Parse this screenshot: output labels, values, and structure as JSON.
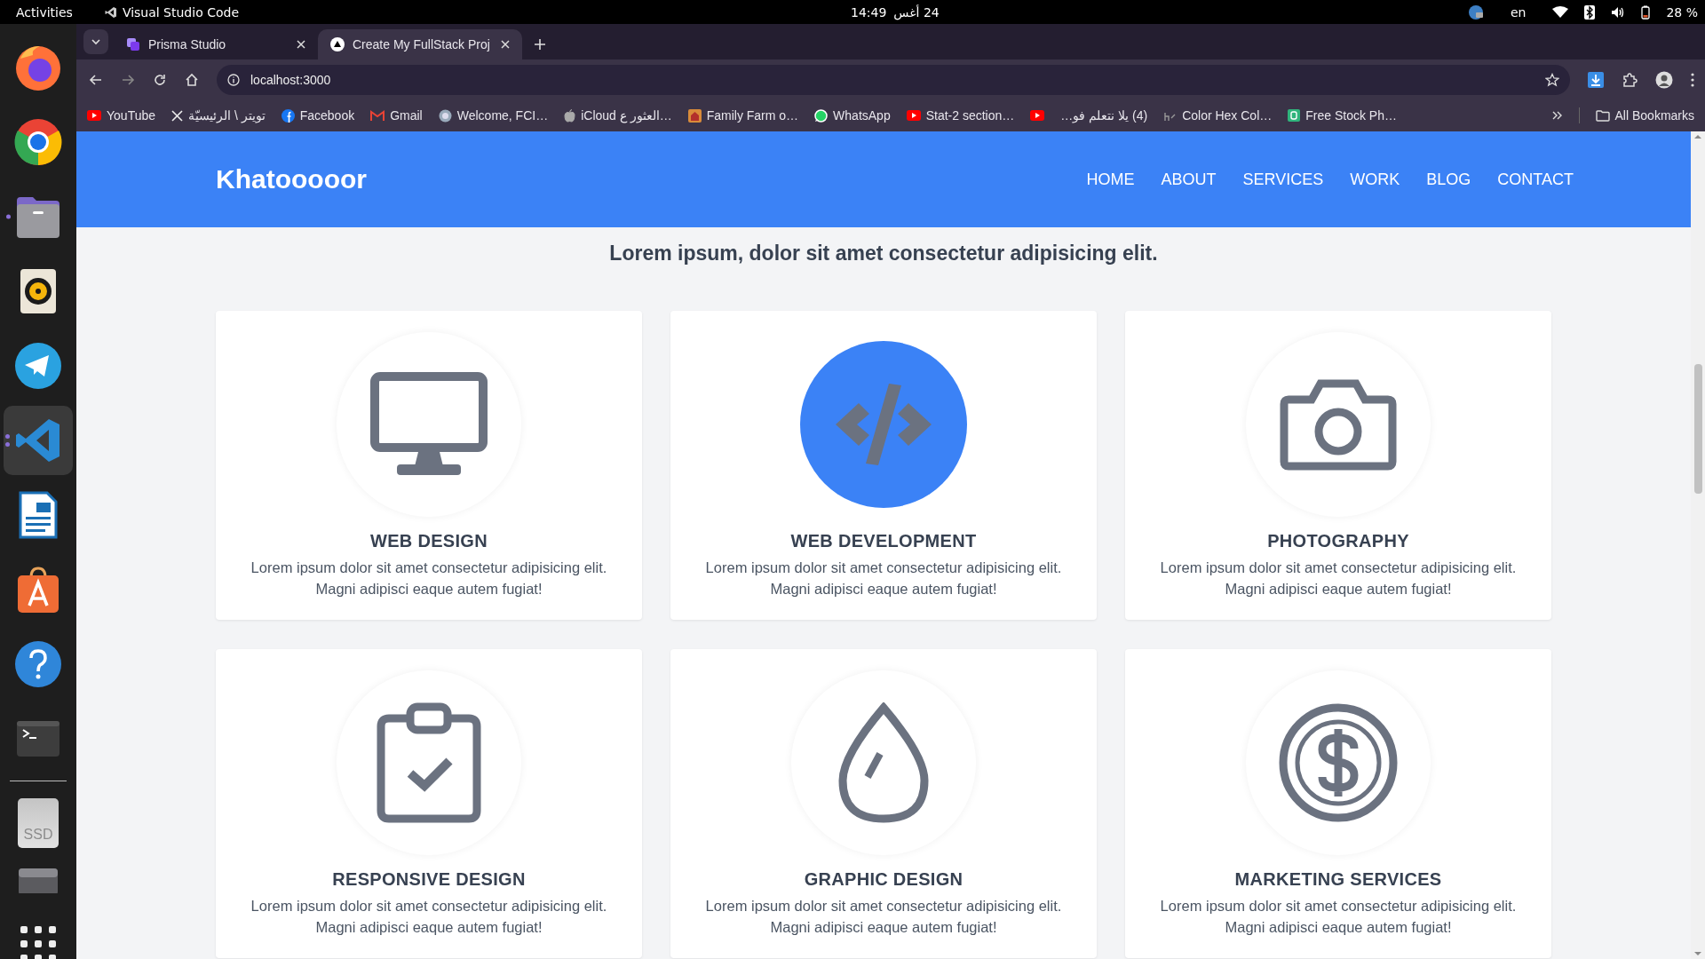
{
  "top_bar": {
    "activities": "Activities",
    "app_name": "Visual Studio Code",
    "time": "14:49",
    "date": "24 أغس",
    "language": "en",
    "battery": "28 %"
  },
  "dock": {
    "items": [
      {
        "kind": "firefox",
        "running": false,
        "selected": false
      },
      {
        "kind": "chrome",
        "running": false,
        "selected": false
      },
      {
        "kind": "files",
        "running": true,
        "selected": false
      },
      {
        "kind": "music",
        "running": false,
        "selected": false
      },
      {
        "kind": "telegram",
        "running": false,
        "selected": false
      },
      {
        "kind": "vscode",
        "running": true,
        "selected": true
      },
      {
        "kind": "writer",
        "running": false,
        "selected": false
      },
      {
        "kind": "appcenter",
        "running": false,
        "selected": false
      },
      {
        "kind": "help",
        "running": false,
        "selected": false
      },
      {
        "kind": "terminal",
        "running": false,
        "selected": false
      },
      {
        "kind": "drive",
        "label": "SSD",
        "running": false,
        "selected": false
      },
      {
        "kind": "drive2",
        "running": false,
        "selected": false
      },
      {
        "kind": "apps",
        "running": false,
        "selected": false
      }
    ]
  },
  "browser": {
    "tabs": [
      {
        "title": "Prisma Studio",
        "kind": "prisma",
        "selected": false
      },
      {
        "title": "Create My FullStack Proj",
        "kind": "triangle",
        "selected": true
      }
    ],
    "address": "localhost:3000",
    "bookmarks": [
      {
        "label": "YouTube",
        "kind": "youtube"
      },
      {
        "label": "تويتر \\ الرئيسيّة",
        "kind": "x"
      },
      {
        "label": "Facebook",
        "kind": "facebook"
      },
      {
        "label": "Gmail",
        "kind": "gmail"
      },
      {
        "label": "Welcome, FCI…",
        "kind": "globe"
      },
      {
        "label": "iCloud العثور ع…",
        "kind": "apple"
      },
      {
        "label": "Family Farm o…",
        "kind": "farm"
      },
      {
        "label": "WhatsApp",
        "kind": "whatsapp"
      },
      {
        "label": "Stat-2 section…",
        "kind": "youtube"
      },
      {
        "kind": "youtube"
      },
      {
        "label": "(4) يلا نتعلم فو…",
        "kind": "none"
      },
      {
        "label": "Color Hex Col…",
        "kind": "colorhex"
      },
      {
        "label": "Free Stock Ph…",
        "kind": "stock"
      }
    ],
    "all_bookmarks": "All Bookmarks"
  },
  "page": {
    "brand": "Khatooooor",
    "nav": [
      {
        "label": "HOME"
      },
      {
        "label": "ABOUT"
      },
      {
        "label": "SERVICES"
      },
      {
        "label": "WORK"
      },
      {
        "label": "BLOG"
      },
      {
        "label": "CONTACT"
      }
    ],
    "heading": "Lorem ipsum, dolor sit amet consectetur adipisicing elit.",
    "services": [
      {
        "title": "WEB DESIGN",
        "text": "Lorem ipsum dolor sit amet consectetur adipisicing elit. Magni adipisci eaque autem fugiat!",
        "kind": "monitor",
        "highlighted": false
      },
      {
        "title": "WEB DEVELOPMENT",
        "text": "Lorem ipsum dolor sit amet consectetur adipisicing elit. Magni adipisci eaque autem fugiat!",
        "kind": "code",
        "highlighted": true
      },
      {
        "title": "PHOTOGRAPHY",
        "text": "Lorem ipsum dolor sit amet consectetur adipisicing elit. Magni adipisci eaque autem fugiat!",
        "kind": "camera",
        "highlighted": false
      },
      {
        "title": "RESPONSIVE DESIGN",
        "text": "Lorem ipsum dolor sit amet consectetur adipisicing elit. Magni adipisci eaque autem fugiat!",
        "kind": "clipboard",
        "highlighted": false
      },
      {
        "title": "GRAPHIC DESIGN",
        "text": "Lorem ipsum dolor sit amet consectetur adipisicing elit. Magni adipisci eaque autem fugiat!",
        "kind": "drop",
        "highlighted": false
      },
      {
        "title": "MARKETING SERVICES",
        "text": "Lorem ipsum dolor sit amet consectetur adipisicing elit. Magni adipisci eaque autem fugiat!",
        "kind": "dollar",
        "highlighted": false
      }
    ]
  }
}
